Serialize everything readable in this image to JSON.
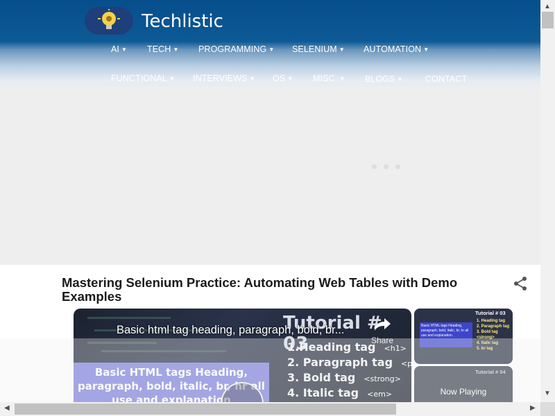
{
  "header": {
    "site_title": "Techlistic",
    "logo_icon": "lightbulb-gear-icon"
  },
  "nav": {
    "row1": [
      {
        "label": "AI",
        "has_dropdown": true
      },
      {
        "label": "TECH",
        "has_dropdown": true
      },
      {
        "label": "PROGRAMMING",
        "has_dropdown": true
      },
      {
        "label": "SELENIUM",
        "has_dropdown": true
      },
      {
        "label": "AUTOMATION",
        "has_dropdown": true
      }
    ],
    "row2": [
      {
        "label": "FUNCTIONAL",
        "has_dropdown": true
      },
      {
        "label": "INTERVIEWS",
        "has_dropdown": true
      },
      {
        "label": "OS",
        "has_dropdown": true
      },
      {
        "label": "MISC.",
        "has_dropdown": true
      },
      {
        "label": "BLOGS",
        "has_dropdown": true
      },
      {
        "label": "CONTACT",
        "has_dropdown": false
      }
    ],
    "caret": "▼"
  },
  "article": {
    "title": "Mastering Selenium Practice: Automating Web Tables with Demo Examples",
    "share_icon": "share-icon"
  },
  "video": {
    "caption": "Basic html tag heading, paragraph, bold, br...",
    "share_label": "Share",
    "card_text": "Basic HTML tags Heading, paragraph, bold, italic, br, hr all use and explanation",
    "tutorial_title": "Tutorial # 03",
    "tutorial_items": [
      {
        "text": "1.Heading tag",
        "tag": "<h1>"
      },
      {
        "text": "2. Paragraph tag",
        "tag": "<p>"
      },
      {
        "text": "3. Bold tag",
        "tag": "<strong>"
      },
      {
        "text": "4.  Italic tag",
        "tag": "<em>"
      }
    ]
  },
  "playlist": {
    "thumb1_title": "Tutorial # 03",
    "thumb1_card": "Basic HTML tags Heading, paragraph, bold, italic, br, hr all use and explanation.",
    "thumb1_list": [
      "1. Heading tag",
      "2. Paragraph tag",
      "3. Bold tag <strong>",
      "4. Italic tag",
      "5. br tag"
    ],
    "thumb2_title": "Tutorial # 04",
    "now_playing": "Now Playing"
  },
  "colors": {
    "header_blue": "#064e8c",
    "ad_gray": "#eeeeee",
    "card_purple": "#7b7fdc"
  }
}
